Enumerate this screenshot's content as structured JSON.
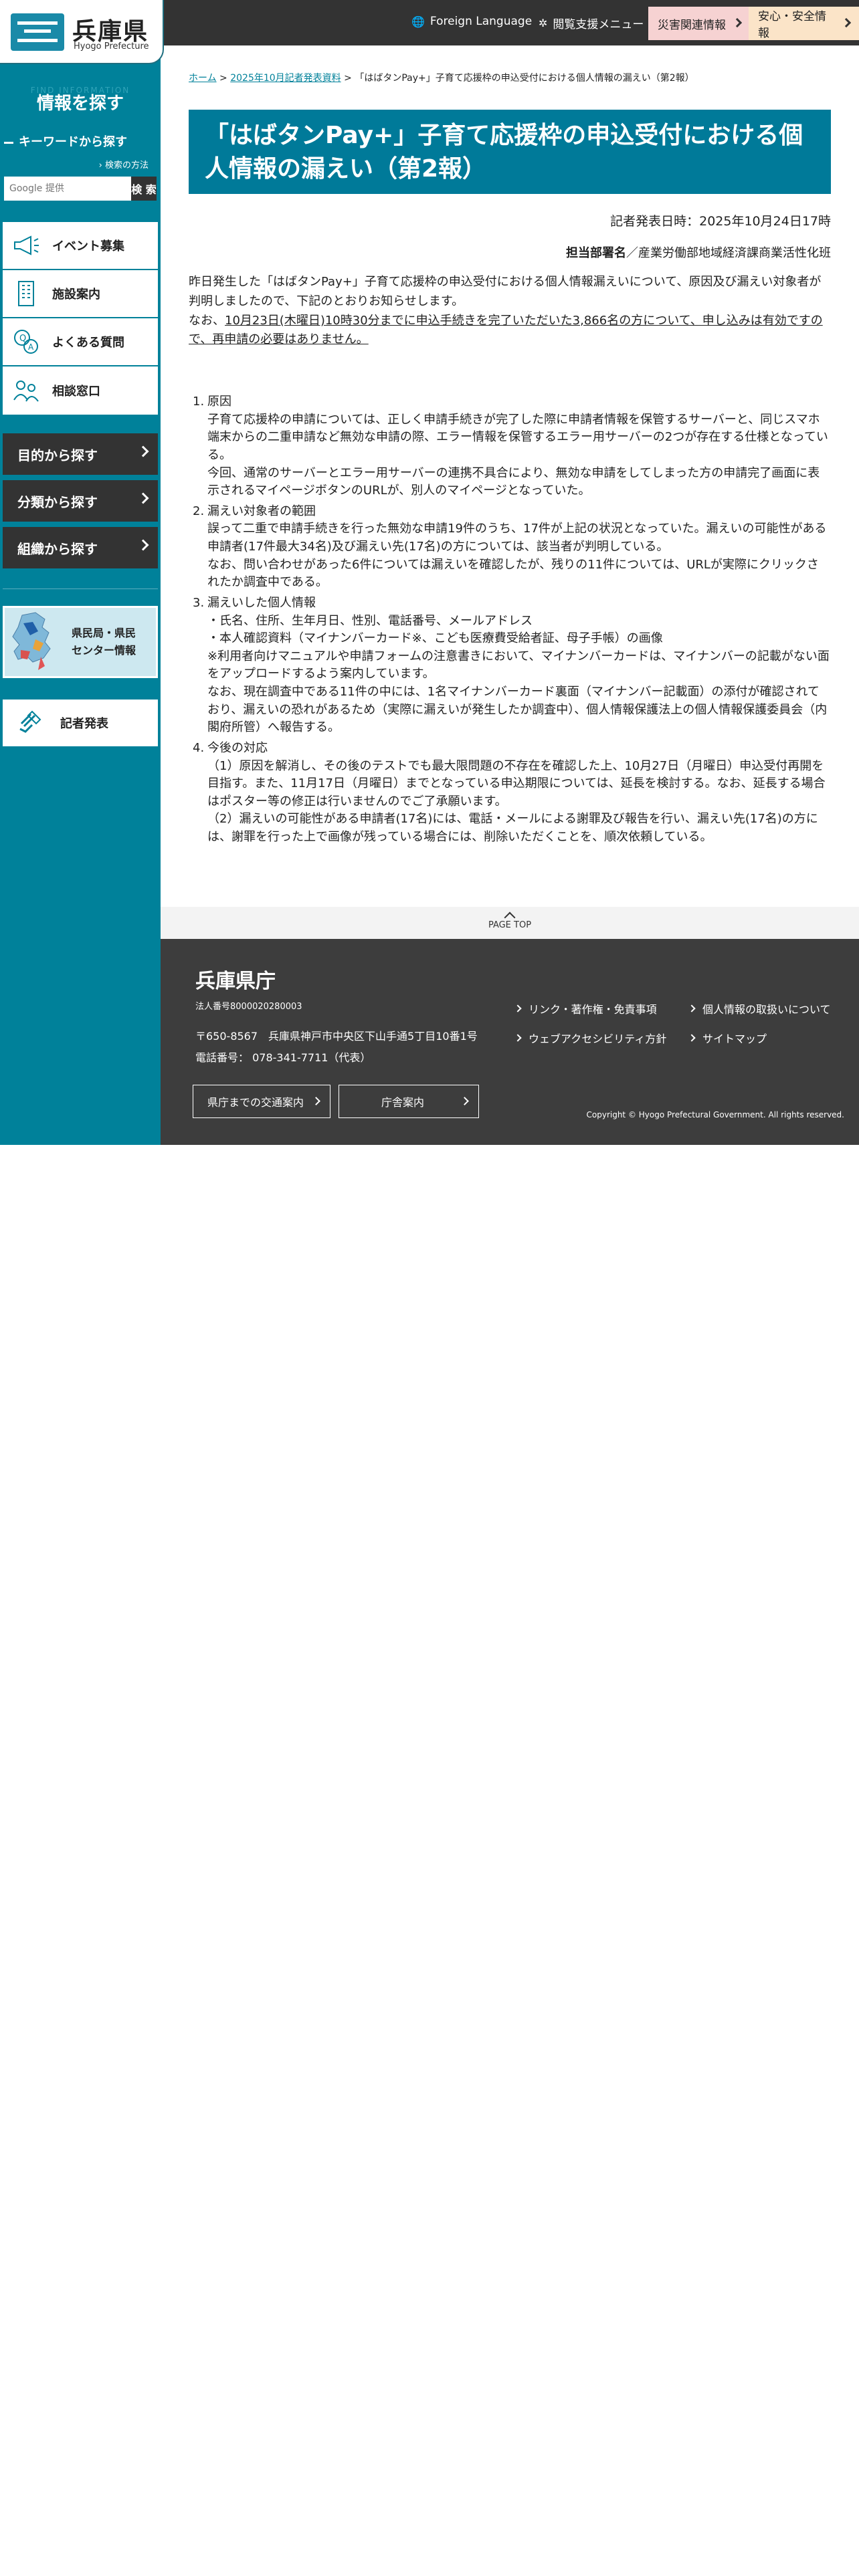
{
  "header": {
    "logo_title": "兵庫県",
    "logo_sub": "Hyogo Prefecture",
    "foreign_language": "Foreign Language",
    "accessibility_menu": "閲覧支援メニュー",
    "disaster_button": "災害関連情報",
    "safety_button": "安心・安全情報"
  },
  "sidebar": {
    "heading": "情報を探す",
    "heading_bg": "FIND INFORMATION",
    "keyword_label": "キーワードから探す",
    "search_help": "検索の方法",
    "search_placeholder": "Google 提供",
    "search_button": "検 索",
    "menu": [
      {
        "label": "イベント募集",
        "icon": "megaphone-icon"
      },
      {
        "label": "施設案内",
        "icon": "building-icon"
      },
      {
        "label": "よくある質問",
        "icon": "faq-icon"
      },
      {
        "label": "相談窓口",
        "icon": "consult-icon"
      }
    ],
    "dark_menu": [
      "目的から探す",
      "分類から探す",
      "組織から探す"
    ],
    "center_info": "県民局・県民\nセンター情報",
    "press": "記者発表"
  },
  "breadcrumb": {
    "home": "ホーム",
    "parent": "2025年10月記者発表資料",
    "current": "「はばタンPay+」子育て応援枠の申込受付における個人情報の漏えい（第2報）"
  },
  "article": {
    "title": "「はばタンPay+」子育て応援枠の申込受付における個人情報の漏えい（第2報）",
    "release_date": "記者発表日時：2025年10月24日17時",
    "dept_label": "担当部署名",
    "dept_name": "／産業労働部地域経済課商業活性化班",
    "intro_1": "昨日発生した「はばタンPay+」子育て応援枠の申込受付における個人情報漏えいについて、原因及び漏えい対象者が判明しましたので、下記のとおりお知らせします。",
    "intro_2a": "なお、",
    "intro_2b": "10月23日(木曜日)10時30分までに申込手続きを完了いただいた3,866名の方について、申し込みは有効ですので、再申請の必要はありません。",
    "items": [
      {
        "num": "1.",
        "title": "原因",
        "lines": [
          "子育て応援枠の申請については、正しく申請手続きが完了した際に申請者情報を保管するサーバーと、同じスマホ端末からの二重申請など無効な申請の際、エラー情報を保管するエラー用サーバーの2つが存在する仕様となっている。",
          "今回、通常のサーバーとエラー用サーバーの連携不具合により、無効な申請をしてしまった方の申請完了画面に表示されるマイページボタンのURLが、別人のマイページとなっていた。"
        ]
      },
      {
        "num": "2.",
        "title": "漏えい対象者の範囲",
        "lines": [
          "誤って二重で申請手続きを行った無効な申請19件のうち、17件が上記の状況となっていた。漏えいの可能性がある申請者(17件最大34名)及び漏えい先(17名)の方については、該当者が判明している。",
          "なお、問い合わせがあった6件については漏えいを確認したが、残りの11件については、URLが実際にクリックされたか調査中である。"
        ]
      },
      {
        "num": "3.",
        "title": "漏えいした個人情報",
        "lines": [
          "・氏名、住所、生年月日、性別、電話番号、メールアドレス",
          "・本人確認資料（マイナンバーカード※、こども医療費受給者証、母子手帳）の画像",
          "※利用者向けマニュアルや申請フォームの注意書きにおいて、マイナンバーカードは、マイナンバーの記載がない面をアップロードするよう案内しています。",
          "なお、現在調査中である11件の中には、1名マイナンバーカード裏面（マイナンバー記載面）の添付が確認されており、漏えいの恐れがあるため（実際に漏えいが発生したか調査中）、個人情報保護法上の個人情報保護委員会（内閣府所管）へ報告する。"
        ]
      },
      {
        "num": "4.",
        "title": "今後の対応",
        "lines": [
          "（1）原因を解消し、その後のテストでも最大限問題の不存在を確認した上、10月27日（月曜日）申込受付再開を目指す。また、11月17日（月曜日）までとなっている申込期限については、延長を検討する。なお、延長する場合はポスター等の修正は行いませんのでご了承願います。",
          "（2）漏えいの可能性がある申請者(17名)には、電話・メールによる謝罪及び報告を行い、漏えい先(17名)の方には、謝罪を行った上で画像が残っている場合には、削除いただくことを、順次依頼している。"
        ]
      }
    ]
  },
  "page_top": "PAGE TOP",
  "footer": {
    "name": "兵庫県庁",
    "corp_no": "法人番号8000020280003",
    "address": "〒650-8567　兵庫県神戸市中央区下山手通5丁目10番1号",
    "tel": "電話番号：  078-341-7711（代表）",
    "btn_access": "県庁までの交通案内",
    "btn_guide": "庁舎案内",
    "links": [
      "リンク・著作権・免責事項",
      "個人情報の取扱いについて",
      "ウェブアクセシビリティ方針",
      "サイトマップ"
    ],
    "copyright": "Copyright © Hyogo Prefectural Government. All rights reserved."
  },
  "colors": {
    "teal": "#00819a",
    "dark": "#333333",
    "disaster_btn": "#f6d2d2",
    "safety_btn": "#fbe4c8"
  }
}
